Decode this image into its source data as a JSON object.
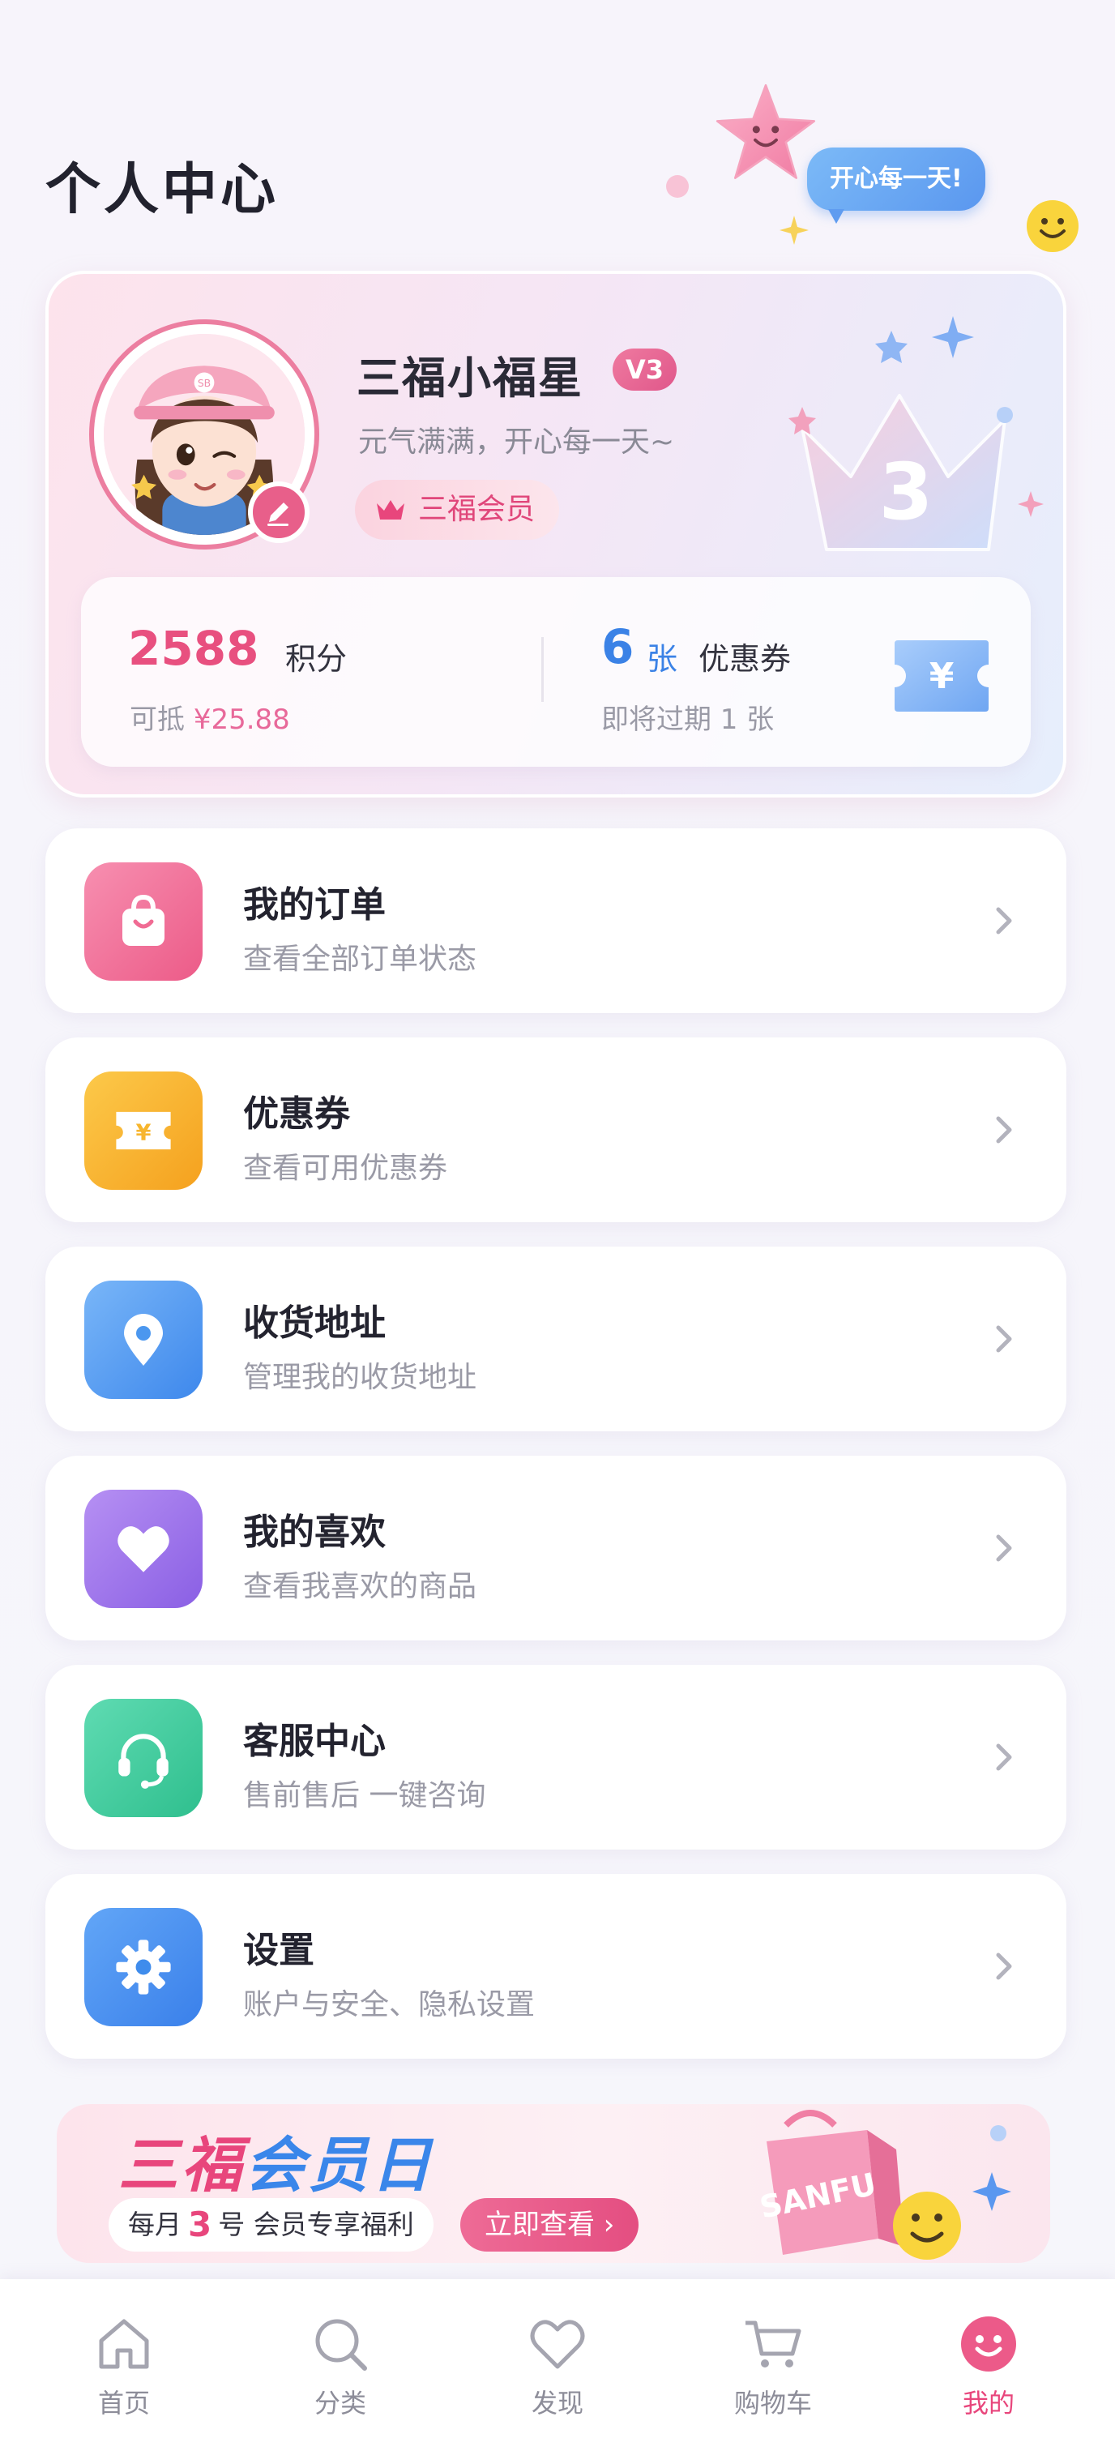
{
  "header": {
    "title": "个人中心",
    "bubble_text": "开心每一天!"
  },
  "profile": {
    "name": "三福小福星",
    "level": "V3",
    "motto": "元气满满，开心每一天~",
    "member_label": "三福会员",
    "crown_number": "3",
    "avatar_cap_text": "SB"
  },
  "stats": {
    "points_value": "2588",
    "points_label": "积分",
    "points_deduct_prefix": "可抵",
    "points_deduct_amount": "¥25.88",
    "coupon_count": "6",
    "coupon_unit": "张",
    "coupon_label": "优惠券",
    "coupon_expiring": "即将过期 1 张",
    "ticket_symbol": "¥"
  },
  "menu": [
    {
      "title": "我的订单",
      "subtitle": "查看全部订单状态",
      "icon": "shopping-bag-icon",
      "color": "#f06b93"
    },
    {
      "title": "优惠券",
      "subtitle": "查看可用优惠券",
      "icon": "coupon-icon",
      "color": "#f7b52d"
    },
    {
      "title": "收货地址",
      "subtitle": "管理我的收货地址",
      "icon": "location-pin-icon",
      "color": "#4b97ef"
    },
    {
      "title": "我的喜欢",
      "subtitle": "查看我喜欢的商品",
      "icon": "heart-icon",
      "color": "#9b6ee8"
    },
    {
      "title": "客服中心",
      "subtitle": "售前售后 一键咨询",
      "icon": "headset-icon",
      "color": "#37c99a"
    },
    {
      "title": "设置",
      "subtitle": "账户与安全、隐私设置",
      "icon": "gear-icon",
      "color": "#3f8cec"
    }
  ],
  "banner": {
    "title_part1": "三福",
    "title_part2": "会员日",
    "sub_prefix": "每月",
    "sub_day": "3",
    "sub_suffix": "号 会员专享福利",
    "cta": "立即查看 ›",
    "bag_text": "SANFU"
  },
  "tabbar": [
    {
      "label": "首页",
      "icon": "home-icon",
      "active": false
    },
    {
      "label": "分类",
      "icon": "search-icon",
      "active": false
    },
    {
      "label": "发现",
      "icon": "heart-outline-icon",
      "active": false
    },
    {
      "label": "购物车",
      "icon": "cart-icon",
      "active": false
    },
    {
      "label": "我的",
      "icon": "smiley-icon",
      "active": true
    }
  ],
  "colors": {
    "accent_pink": "#e8467c",
    "accent_blue": "#3a86ea"
  }
}
